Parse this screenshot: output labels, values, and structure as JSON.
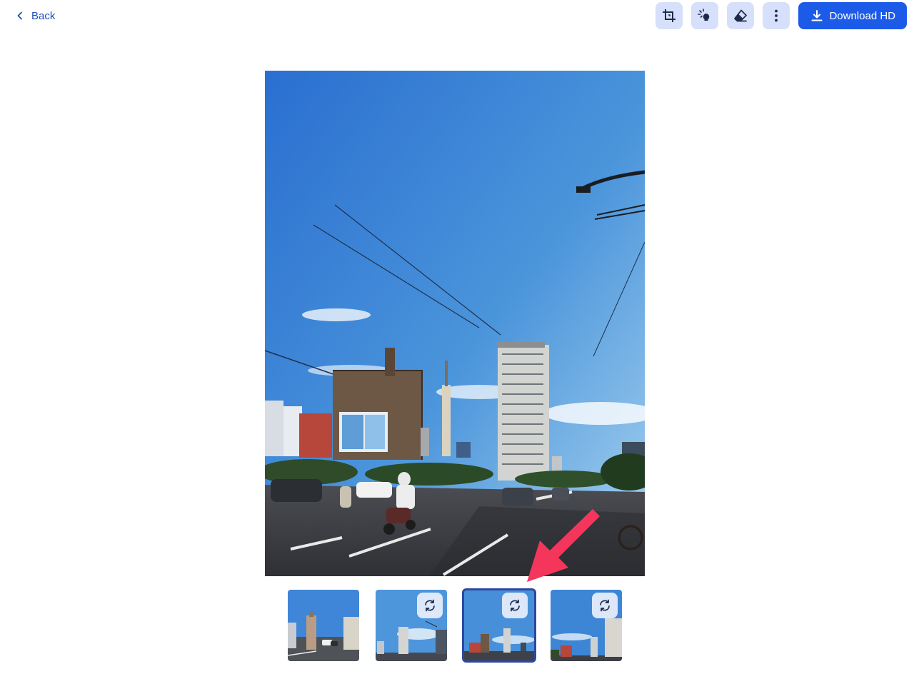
{
  "header": {
    "back_label": "Back",
    "toolbar": [
      {
        "name": "crop-button",
        "icon": "crop-icon"
      },
      {
        "name": "enhance-button",
        "icon": "magic-bulb-icon"
      },
      {
        "name": "eraser-button",
        "icon": "eraser-icon"
      },
      {
        "name": "more-options-button",
        "icon": "more-vertical-icon"
      }
    ],
    "download_label": "Download HD",
    "download_icon": "download-icon"
  },
  "image": {
    "subject": "city street with motorbikes, tall buildings and blue sky"
  },
  "thumbnails": [
    {
      "name": "thumbnail-1",
      "selected": false,
      "has_variant_icon": false
    },
    {
      "name": "thumbnail-2",
      "selected": false,
      "has_variant_icon": true
    },
    {
      "name": "thumbnail-3",
      "selected": true,
      "has_variant_icon": true
    },
    {
      "name": "thumbnail-4",
      "selected": false,
      "has_variant_icon": true
    }
  ],
  "annotation": {
    "icon": "pointer-arrow-icon",
    "color": "#f5365c"
  },
  "colors": {
    "accent": "#1c5be8",
    "back_link": "#1f4fb5",
    "tool_button_bg": "#d7e0fb",
    "selected_outline": "#2c48a0"
  }
}
